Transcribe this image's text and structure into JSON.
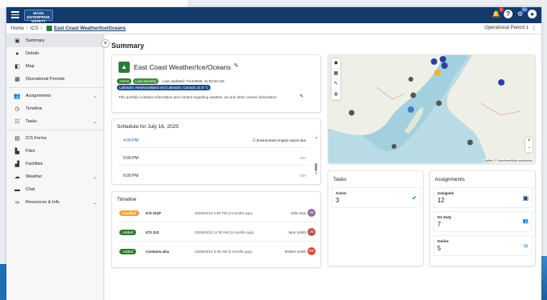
{
  "topbar": {
    "logo_text": "MASS ENTERPRISE SAFETY",
    "notifications_badge": "1",
    "apps_badge": "10"
  },
  "breadcrumb": {
    "home": "Home",
    "ics": "ICS",
    "current": "East Coast Weather/Ice/Oceans",
    "operational_period": "Operational Period 1"
  },
  "sidebar": {
    "items": [
      {
        "label": "Summary",
        "icon": "clipboard-icon"
      },
      {
        "label": "Details",
        "icon": "info-icon"
      },
      {
        "label": "Map",
        "icon": "map-icon"
      },
      {
        "label": "Operational Periods",
        "icon": "calendar-icon"
      },
      {
        "label": "Assignments",
        "icon": "people-icon"
      },
      {
        "label": "Timeline",
        "icon": "history-icon"
      },
      {
        "label": "Tasks",
        "icon": "tasks-icon"
      },
      {
        "label": "ICS Forms",
        "icon": "form-icon"
      },
      {
        "label": "Files",
        "icon": "file-icon"
      },
      {
        "label": "Facilities",
        "icon": "facility-icon"
      },
      {
        "label": "Weather",
        "icon": "cloud-icon"
      },
      {
        "label": "Chat",
        "icon": "chat-icon"
      },
      {
        "label": "Resources & Info",
        "icon": "link-icon"
      }
    ]
  },
  "summary": {
    "page_title": "Summary",
    "incident_title": "East Coast Weather/Ice/Oceans",
    "status_chip": "Active",
    "severity_chip": "Low Severity",
    "last_updated": "Last Updated: 7/14/2025, 11:03:40 AM",
    "location_chip": "Labrador, Newfoundland and Labrador, Canada 15.0° C",
    "description": "This portfolio contains information and content regarding weather, ice and other oceans information."
  },
  "schedule": {
    "title": "Schedule for July 16, 2025",
    "rows": [
      {
        "time": "4:00 PM",
        "event": "Environment impact report due"
      },
      {
        "time": "5:00 PM",
        "event": "N/A"
      },
      {
        "time": "6:00 PM",
        "event": "N/A"
      }
    ]
  },
  "timeline": {
    "title": "Timeline",
    "rows": [
      {
        "action": "Modified",
        "file": "ICS 211P",
        "date": "2025/04/16 2:00 PM (3 months ago)",
        "user": "John Doe",
        "initials": "JD"
      },
      {
        "action": "Added",
        "file": "ICS 213",
        "date": "2025/04/15 11:30 AM (3 months ago)",
        "user": "Jane Smith",
        "initials": "JS"
      },
      {
        "action": "Added",
        "file": "Contacts.xlsx",
        "date": "2025/04/14 8:45 AM (3 months ago)",
        "user": "Robert Smith",
        "initials": "RS"
      }
    ]
  },
  "map": {
    "attribution": "Leaflet | © OpenStreetMap contributors"
  },
  "tasks": {
    "title": "Tasks",
    "active_label": "Active",
    "active_value": "3"
  },
  "assignments": {
    "title": "Assignments",
    "assigned_label": "Assigned",
    "assigned_value": "12",
    "onduty_label": "On Duty",
    "onduty_value": "7",
    "online_label": "Online",
    "online_value": "5"
  }
}
